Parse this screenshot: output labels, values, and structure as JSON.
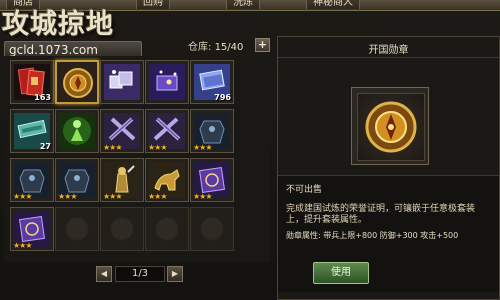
{
  "tabs": [
    "商店",
    "回购",
    "洗炼",
    "神秘商人"
  ],
  "logo": {
    "title": "攻城掠地",
    "site": "gcld.1073.com"
  },
  "storage": {
    "label": "仓库:",
    "count": "15/40",
    "add_label": "+"
  },
  "items": [
    {
      "icon": "red-banner-tokens",
      "count": "163",
      "stars": 0
    },
    {
      "icon": "founding-medal",
      "count": "",
      "stars": 0,
      "selected": true
    },
    {
      "icon": "purple-crystal-cubes",
      "count": "",
      "stars": 0
    },
    {
      "icon": "purple-starry-box",
      "count": "",
      "stars": 0
    },
    {
      "icon": "blue-scroll-tickets",
      "count": "796",
      "stars": 0
    },
    {
      "icon": "teal-scroll-bundle",
      "count": "27",
      "stars": 0
    },
    {
      "icon": "green-aura-figure",
      "count": "",
      "stars": 0
    },
    {
      "icon": "purple-crossed-swords",
      "count": "",
      "stars": 3
    },
    {
      "icon": "purple-crossed-swords",
      "count": "",
      "stars": 3
    },
    {
      "icon": "dark-armor",
      "count": "",
      "stars": 3
    },
    {
      "icon": "dark-armor",
      "count": "",
      "stars": 3
    },
    {
      "icon": "dark-armor",
      "count": "",
      "stars": 3
    },
    {
      "icon": "golden-warrior",
      "count": "",
      "stars": 3
    },
    {
      "icon": "golden-mount",
      "count": "",
      "stars": 3
    },
    {
      "icon": "purple-scroll",
      "count": "",
      "stars": 3
    },
    {
      "icon": "purple-scroll",
      "count": "",
      "stars": 3
    }
  ],
  "pager": {
    "prev": "◀",
    "page": "1/3",
    "next": "▶"
  },
  "detail": {
    "title": "开国勋章",
    "trade_status": "不可出售",
    "description": "完成建国试炼的荣誉证明，可镶嵌于任意极套装上，提升套装属性。",
    "attributes": "勋章属性: 带兵上限+800  防御+300  攻击+500",
    "use_label": "使用"
  },
  "colors": {
    "accent_gold": "#c59a35",
    "use_green": "#4f7b3f",
    "star": "#f2b319"
  }
}
